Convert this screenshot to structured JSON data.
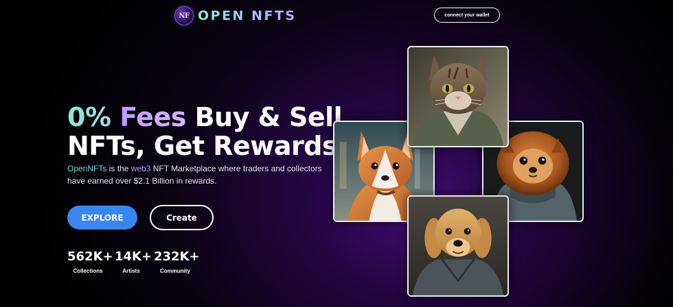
{
  "header": {
    "logo_mark": "NF",
    "logo_text": "OPEN NFTS",
    "wallet_button": "connect your wallet"
  },
  "hero": {
    "title_part1": "0%",
    "title_part2": "Fees",
    "title_part3": "Buy & Sell",
    "title_line2": "NFTs, Get Rewards",
    "subtitle_brand": "OpenNFTs",
    "subtitle_is": " is the ",
    "subtitle_web3": "web3",
    "subtitle_rest": " NFT Marketplace where traders and collectors have earned over $2.1 Billion in rewards.",
    "explore_button": "EXPLORE",
    "create_button": "Create"
  },
  "stats": [
    {
      "value": "562K+",
      "label": "Collections"
    },
    {
      "value": "14K+",
      "label": "Artists"
    },
    {
      "value": "232K+",
      "label": "Community"
    }
  ],
  "nft_cards": [
    {
      "subject": "cat-in-hoodie",
      "accent": "#6b7a5a"
    },
    {
      "subject": "corgi",
      "accent": "#d9823f"
    },
    {
      "subject": "pomeranian-in-hoodie",
      "accent": "#b8662a"
    },
    {
      "subject": "golden-retriever-in-jacket",
      "accent": "#d4a060"
    }
  ],
  "colors": {
    "background": "#000000",
    "glow": "#46127a",
    "explore_button": "#3a86ef",
    "gradient_cyan": "#86e8d2",
    "gradient_purple": "#b99cff"
  }
}
